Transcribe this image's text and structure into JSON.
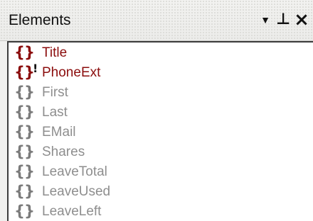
{
  "panel": {
    "title": "Elements",
    "controls": {
      "menu": "▾",
      "pin": "ᵖ",
      "close": "×"
    }
  },
  "elements": [
    {
      "label": "Title",
      "braces": "{}",
      "marker": "",
      "state": "active"
    },
    {
      "label": "PhoneExt",
      "braces": "{}",
      "marker": "!",
      "state": "active"
    },
    {
      "label": "First",
      "braces": "{}",
      "marker": "",
      "state": "inactive"
    },
    {
      "label": "Last",
      "braces": "{}",
      "marker": "",
      "state": "inactive"
    },
    {
      "label": "EMail",
      "braces": "{}",
      "marker": "",
      "state": "inactive"
    },
    {
      "label": "Shares",
      "braces": "{}",
      "marker": "",
      "state": "inactive"
    },
    {
      "label": "LeaveTotal",
      "braces": "{}",
      "marker": "",
      "state": "inactive"
    },
    {
      "label": "LeaveUsed",
      "braces": "{}",
      "marker": "",
      "state": "inactive"
    },
    {
      "label": "LeaveLeft",
      "braces": "{}",
      "marker": "",
      "state": "inactive"
    }
  ],
  "colors": {
    "active": "#8b0d0d",
    "inactive": "#8e8e8e"
  }
}
